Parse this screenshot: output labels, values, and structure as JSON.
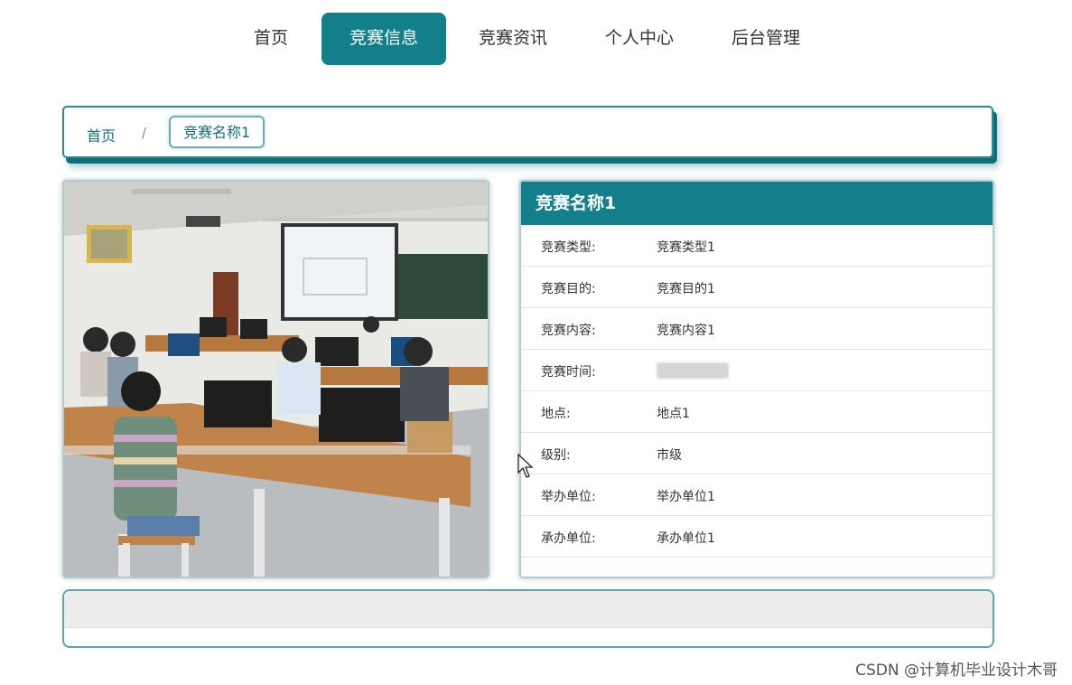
{
  "nav": {
    "items": [
      "首页",
      "竞赛信息",
      "竞赛资讯",
      "个人中心",
      "后台管理"
    ],
    "active": "竞赛信息"
  },
  "breadcrumb": {
    "home": "首页",
    "separator": "/",
    "current": "竞赛名称1"
  },
  "detail": {
    "title": "竞赛名称1",
    "rows": [
      {
        "label": "竞赛类型:",
        "value": "竞赛类型1"
      },
      {
        "label": "竞赛目的:",
        "value": "竞赛目的1"
      },
      {
        "label": "竞赛内容:",
        "value": "竞赛内容1"
      },
      {
        "label": "竞赛时间:",
        "value": ""
      },
      {
        "label": "地点:",
        "value": "地点1"
      },
      {
        "label": "级别:",
        "value": "市级"
      },
      {
        "label": "举办单位:",
        "value": "举办单位1"
      },
      {
        "label": "承办单位:",
        "value": "承办单位1"
      }
    ]
  },
  "watermark": "CSDN @计算机毕业设计木哥",
  "colors": {
    "accent": "#127f8a",
    "border": "#2c8b94"
  }
}
